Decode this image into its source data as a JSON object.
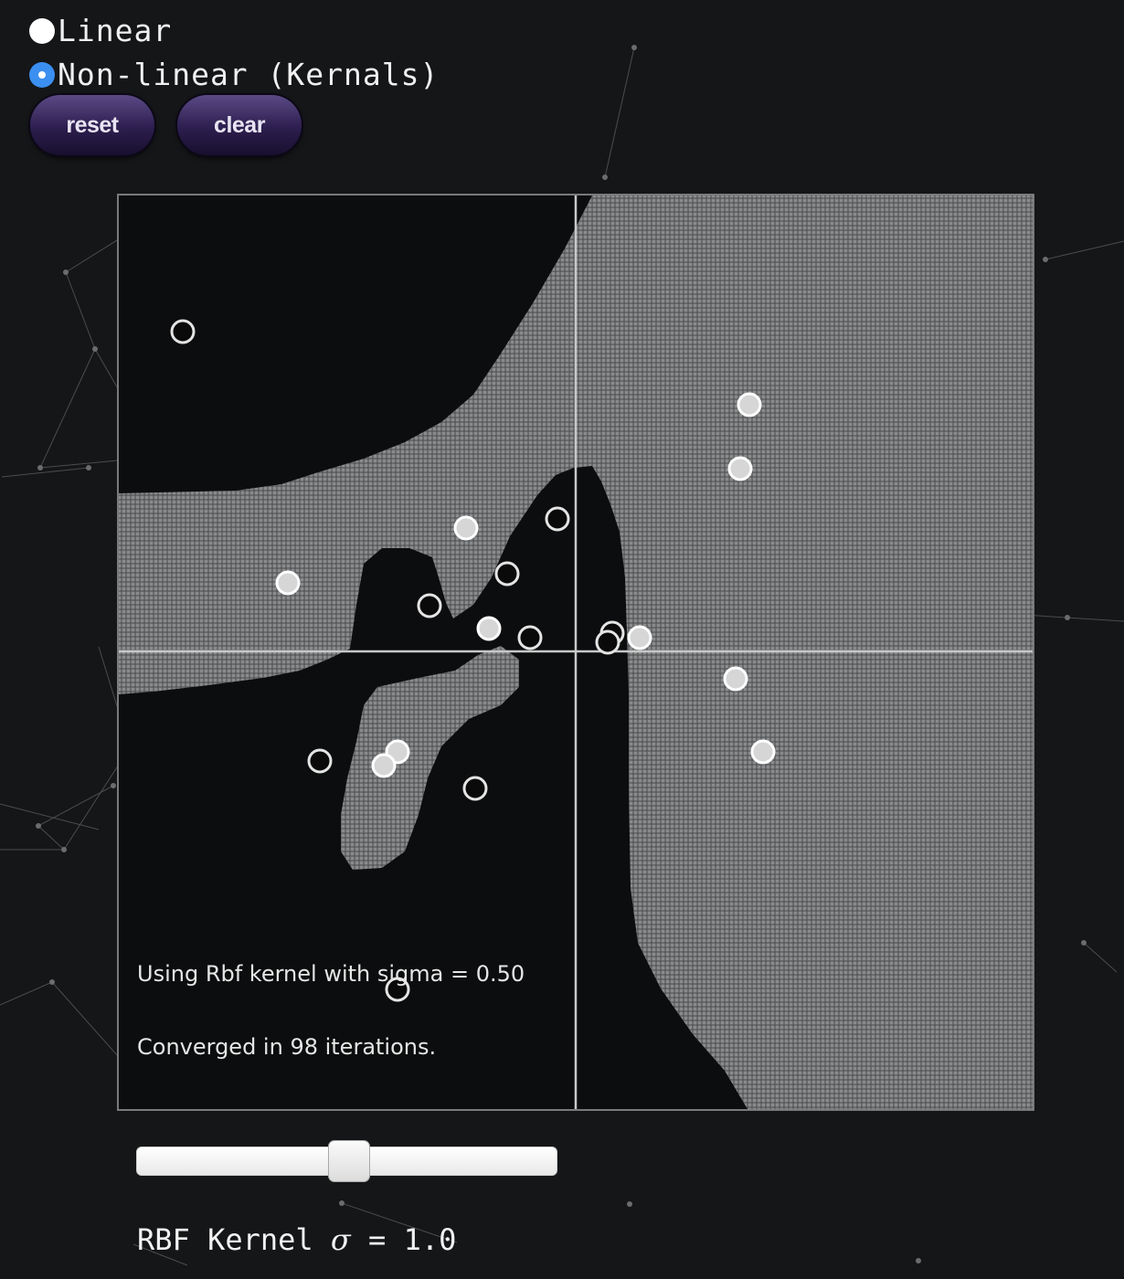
{
  "mode_options": [
    {
      "label": "Linear",
      "selected": false
    },
    {
      "label": "Non-linear (Kernals)",
      "selected": true
    }
  ],
  "buttons": {
    "reset": "reset",
    "clear": "clear"
  },
  "plot": {
    "status_line_1": "Using Rbf kernel with sigma = 0.50",
    "status_line_2": "Converged in 98 iterations.",
    "points": [
      {
        "x": -0.86,
        "y": 0.7,
        "class": "negative"
      },
      {
        "x": 0.38,
        "y": 0.54,
        "class": "positive"
      },
      {
        "x": 0.36,
        "y": 0.4,
        "class": "positive"
      },
      {
        "x": -0.04,
        "y": 0.29,
        "class": "negative"
      },
      {
        "x": -0.24,
        "y": 0.27,
        "class": "positive"
      },
      {
        "x": -0.63,
        "y": 0.15,
        "class": "positive"
      },
      {
        "x": -0.15,
        "y": 0.17,
        "class": "negative"
      },
      {
        "x": -0.32,
        "y": 0.1,
        "class": "negative"
      },
      {
        "x": -0.19,
        "y": 0.05,
        "class": "positive"
      },
      {
        "x": -0.1,
        "y": 0.03,
        "class": "negative"
      },
      {
        "x": 0.08,
        "y": 0.04,
        "class": "negative"
      },
      {
        "x": 0.07,
        "y": 0.02,
        "class": "negative"
      },
      {
        "x": 0.14,
        "y": 0.03,
        "class": "positive"
      },
      {
        "x": 0.35,
        "y": -0.06,
        "class": "positive"
      },
      {
        "x": 0.41,
        "y": -0.22,
        "class": "positive"
      },
      {
        "x": -0.56,
        "y": -0.24,
        "class": "negative"
      },
      {
        "x": -0.39,
        "y": -0.22,
        "class": "positive"
      },
      {
        "x": -0.42,
        "y": -0.25,
        "class": "positive"
      },
      {
        "x": -0.22,
        "y": -0.3,
        "class": "negative"
      },
      {
        "x": -0.39,
        "y": -0.74,
        "class": "negative"
      }
    ]
  },
  "slider": {
    "value_fraction": 0.505
  },
  "kernel_label": {
    "prefix": "RBF Kernel ",
    "symbol": "σ",
    "suffix": " = 1.0"
  },
  "colors": {
    "background": "#141618",
    "region_positive": "#6a6a6a",
    "region_negative": "#0c0d0e",
    "radio_selected": "#3b8ff0",
    "button_purple": "#3a2a62"
  }
}
